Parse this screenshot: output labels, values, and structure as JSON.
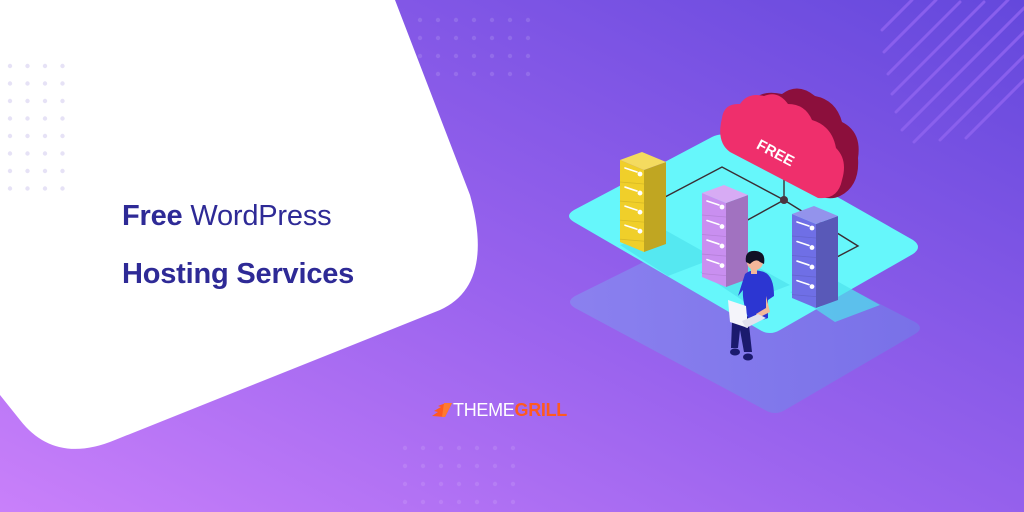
{
  "banner": {
    "headline": {
      "line1_bold": "Free",
      "line1_regular": "WordPress",
      "line2": "Hosting Services"
    },
    "cloud_label": "FREE",
    "brand": {
      "part1": "THEME",
      "part2": "GRILL"
    }
  },
  "colors": {
    "headline": "#2e2a96",
    "bg_left": "#c17ef6",
    "bg_right": "#6a49dd",
    "platform": "#66f5fa",
    "cloud": "#ef2f6c",
    "cloud_shade": "#8c0f3c",
    "server_yellow": "#f0cf2a",
    "server_purple": "#c98ff0",
    "server_blue": "#6f6fe6",
    "brand_orange": "#ff5a1f"
  }
}
